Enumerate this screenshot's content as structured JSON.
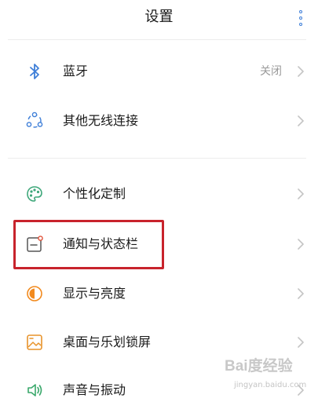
{
  "header": {
    "title": "设置",
    "more_icon": "more-vertical-icon"
  },
  "colors": {
    "accent": "#3f7fd8",
    "highlight_box": "#c8232c",
    "text_primary": "#1a1a1a",
    "text_secondary": "#9a9a9a"
  },
  "settings": {
    "items": [
      {
        "label": "蓝牙",
        "value": "关闭",
        "icon": "bluetooth-icon"
      },
      {
        "label": "其他无线连接",
        "value": "",
        "icon": "wireless-connections-icon"
      },
      {
        "label": "个性化定制",
        "value": "",
        "icon": "palette-icon"
      },
      {
        "label": "通知与状态栏",
        "value": "",
        "icon": "notification-bar-icon"
      },
      {
        "label": "显示与亮度",
        "value": "",
        "icon": "brightness-icon"
      },
      {
        "label": "桌面与乐划锁屏",
        "value": "",
        "icon": "wallpaper-icon"
      },
      {
        "label": "声音与振动",
        "value": "",
        "icon": "sound-icon"
      }
    ]
  },
  "watermark": {
    "brand": "Bai度经验",
    "sub": "jingyan.baidu.com"
  }
}
